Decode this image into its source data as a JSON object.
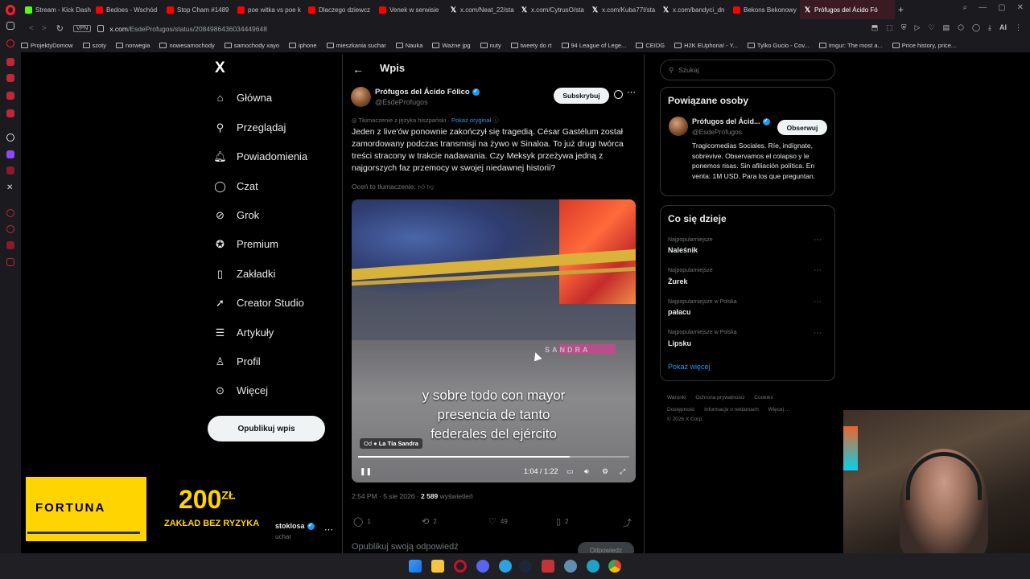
{
  "browser": {
    "tabs": [
      {
        "label": "Stream - Kick Dash",
        "icon": "kick-icon"
      },
      {
        "label": "Bedoes - Wschód",
        "icon": "youtube-icon"
      },
      {
        "label": "Stop Cham #1489",
        "icon": "youtube-icon"
      },
      {
        "label": "poe witka vs poe k",
        "icon": "youtube-icon"
      },
      {
        "label": "Dlaczego dziewcz",
        "icon": "youtube-icon"
      },
      {
        "label": "Venek w serwisie",
        "icon": "youtube-icon"
      },
      {
        "label": "x.com/Neat_22/sta",
        "icon": "x-icon"
      },
      {
        "label": "x.com/CytrusO/sta",
        "icon": "x-icon"
      },
      {
        "label": "x.com/Kuba77I/sta",
        "icon": "x-icon"
      },
      {
        "label": "x.com/bandyci_dn",
        "icon": "x-icon"
      },
      {
        "label": "Bekons Bekonowy",
        "icon": "youtube-icon"
      },
      {
        "label": "Prófugos del Ácido Fó",
        "icon": "x-icon",
        "active": true
      }
    ],
    "url_host": "x.com",
    "url_path": "/EsdeProfugos/status/2084986436034449648",
    "vpn_label": "VPN",
    "ai_label": "AI",
    "bookmarks": [
      "ProjektyDomow",
      "szoty",
      "norwegia",
      "nowesamochody",
      "samochody xayo",
      "iphone",
      "mieszkania suchar",
      "Nauka",
      "Ważne jpg",
      "nuty",
      "tweety do rt",
      "94 League of Lege...",
      "CEIDG",
      "H2K EUphoria! - Y...",
      "Tylko Gucio - Cov...",
      "Imgur: The most a...",
      "Price history, price..."
    ]
  },
  "nav": {
    "logo": "X",
    "items": [
      {
        "label": "Główna",
        "icon": "home-icon"
      },
      {
        "label": "Przeglądaj",
        "icon": "search-icon"
      },
      {
        "label": "Powiadomienia",
        "icon": "bell-icon"
      },
      {
        "label": "Czat",
        "icon": "chat-icon"
      },
      {
        "label": "Grok",
        "icon": "grok-icon"
      },
      {
        "label": "Premium",
        "icon": "premium-icon"
      },
      {
        "label": "Zakładki",
        "icon": "bookmark-icon"
      },
      {
        "label": "Creator Studio",
        "icon": "rocket-icon"
      },
      {
        "label": "Artykuły",
        "icon": "article-icon"
      },
      {
        "label": "Profil",
        "icon": "person-icon"
      },
      {
        "label": "Więcej",
        "icon": "more-icon"
      }
    ],
    "publish_label": "Opublikuj wpis",
    "account_name": "stoklosa",
    "account_handle": "uchar"
  },
  "post": {
    "header_title": "Wpis",
    "author_name": "Prófugos del Ácido Fólico",
    "author_handle": "@EsdeProfugos",
    "subscribe_label": "Subskrybuj",
    "translated_from": "Tłumaczenie z języka hiszpański",
    "show_original": "Pokaż oryginał",
    "text": "Jeden z live'ów ponownie zakończył się tragedią. César Gastélum został zamordowany podczas transmisji na żywo w Sinaloa. To już drugi twórca treści stracony w trakcie nadawania. Czy Meksyk przeżywa jedną z najgorszych faz przemocy w swojej niedawnej historii?",
    "rate_translation": "Oceń to tłumaczenie:",
    "video": {
      "watermark": "SANDRA",
      "subtitle_line1": "y sobre todo con mayor",
      "subtitle_line2": "presencia de tanto",
      "subtitle_line3": "federales del ejército",
      "source_prefix": "Od",
      "source_name": "La Tía Sandra",
      "time": "1:04 / 1:22",
      "progress": 0.78
    },
    "time": "2:54 PM · 5 sie 2026",
    "views_count": "2 589",
    "views_label": "wyświetleń",
    "replies": "1",
    "reposts": "2",
    "likes": "49",
    "bookmarks": "2",
    "reply_placeholder": "Opublikuj swoją odpowiedź",
    "reply_button": "Odpowiedz"
  },
  "right": {
    "search_placeholder": "Szukaj",
    "related_title": "Powiązane osoby",
    "related_name": "Prófugos del Ácid...",
    "related_handle": "@EsdeProfugos",
    "follow_label": "Obserwuj",
    "related_bio": "Tragicomedias Sociales. Ríe, indígnate, sobrevive. Observamos el colapso y le ponemos risas. Sin afiliación política. En venta: 1M USD. Para los que preguntan.",
    "trends_title": "Co się dzieje",
    "trends": [
      {
        "category": "Najpopularniejsze",
        "name": "Naleśnik"
      },
      {
        "category": "Najpopularniejsze",
        "name": "Żurek"
      },
      {
        "category": "Najpopularniejsze w Polska",
        "name": "pałacu"
      },
      {
        "category": "Najpopularniejsze w Polska",
        "name": "Lipsku"
      }
    ],
    "show_more": "Pokaż więcej",
    "footer_line1": [
      "Warunki",
      "Ochrona prywatności",
      "Cookies"
    ],
    "footer_line2": [
      "Dostępność",
      "Informacje o reklamach",
      "Więcej ..."
    ],
    "footer_copy": "© 2026 X Corp."
  },
  "ad": {
    "brand": "FORTUNA",
    "amount": "200",
    "currency": "ZŁ",
    "tagline": "ZAKŁAD BEZ RYZYKA"
  },
  "colors": {
    "accent": "#1d9bf0",
    "background": "#000000",
    "ad_yellow": "#ffd400"
  }
}
